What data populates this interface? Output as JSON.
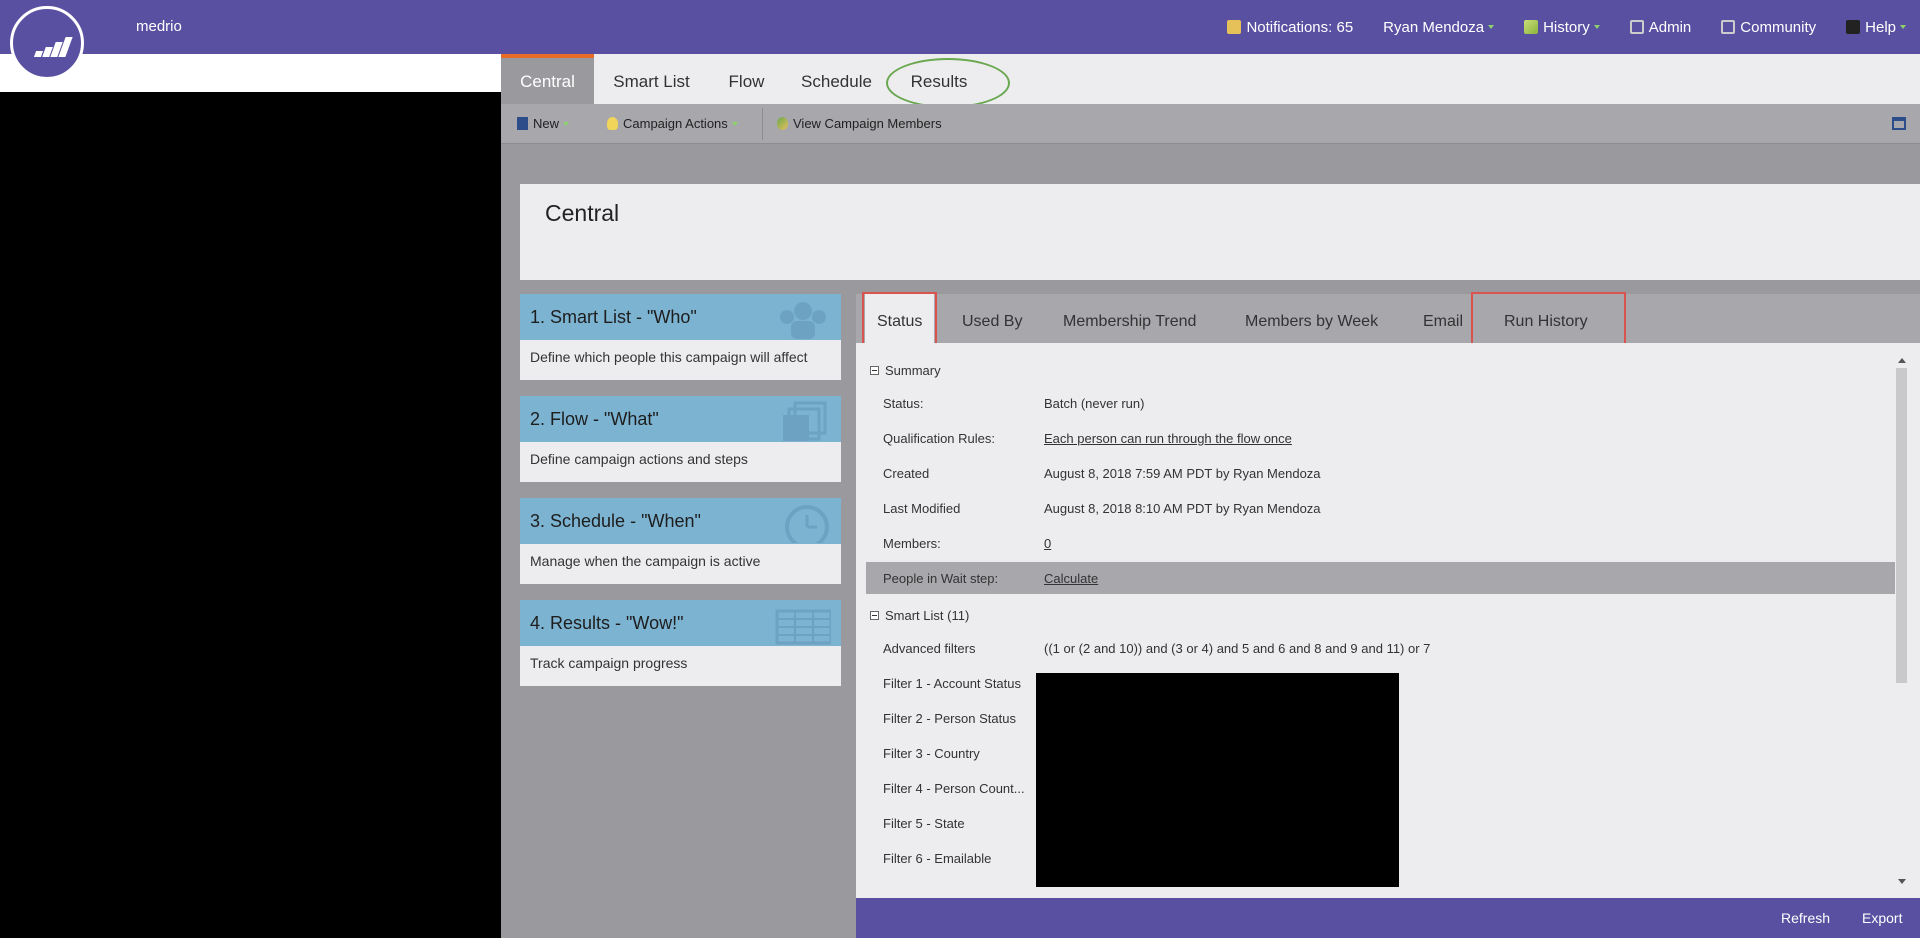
{
  "header": {
    "brand": "medrio",
    "nav": [
      {
        "label": "Notifications: 65",
        "icon": "notification-icon"
      },
      {
        "label": "Ryan Mendoza",
        "icon": null
      },
      {
        "label": "History",
        "icon": "history-icon"
      },
      {
        "label": "Admin",
        "icon": "gear-icon"
      },
      {
        "label": "Community",
        "icon": "community-icon"
      },
      {
        "label": "Help",
        "icon": "help-icon"
      }
    ]
  },
  "tabs": [
    "Central",
    "Smart List",
    "Flow",
    "Schedule",
    "Results"
  ],
  "active_tab": "Central",
  "toolbar": {
    "new_label": "New",
    "campaign_actions_label": "Campaign Actions",
    "view_members_label": "View Campaign Members"
  },
  "page_title": "Central",
  "steps": [
    {
      "title": "1. Smart List - \"Who\"",
      "desc": "Define which people this campaign will affect",
      "icon": "people-icon"
    },
    {
      "title": "2. Flow - \"What\"",
      "desc": "Define campaign actions and steps",
      "icon": "stack-icon"
    },
    {
      "title": "3. Schedule - \"When\"",
      "desc": "Manage when the campaign is active",
      "icon": "clock-icon"
    },
    {
      "title": "4. Results - \"Wow!\"",
      "desc": "Track campaign progress",
      "icon": "table-icon"
    }
  ],
  "detail_tabs": [
    "Status",
    "Used By",
    "Membership Trend",
    "Members by Week",
    "Email",
    "Run History"
  ],
  "summary": {
    "heading": "Summary",
    "rows": [
      {
        "label": "Status:",
        "value": "Batch (never run)"
      },
      {
        "label": "Qualification Rules:",
        "value": "Each person can run through the flow once"
      },
      {
        "label": "Created",
        "value": "August 8, 2018 7:59 AM PDT by Ryan Mendoza"
      },
      {
        "label": "Last Modified",
        "value": "August 8, 2018 8:10 AM PDT by Ryan Mendoza"
      },
      {
        "label": "Members:",
        "value": "0"
      },
      {
        "label": "People in Wait step:",
        "value": "Calculate"
      }
    ]
  },
  "smart_list": {
    "heading": "Smart List (11)",
    "advanced_label": "Advanced filters",
    "advanced_value": "((1 or (2 and 10)) and (3 or 4) and 5 and 6 and 8 and 9 and 11) or 7",
    "filters": [
      "Filter 1 - Account Status",
      "Filter 2 - Person Status",
      "Filter 3 - Country",
      "Filter 4 - Person Count...",
      "Filter 5 - State",
      "Filter 6 - Emailable"
    ]
  },
  "footer": {
    "refresh": "Refresh",
    "export": "Export"
  },
  "colors": {
    "brand_purple": "#5a50a1",
    "tab_accent": "#e86b28",
    "step_blue": "#7cb3d1",
    "highlight_red": "#d9534f",
    "highlight_green": "#6aa84f"
  }
}
